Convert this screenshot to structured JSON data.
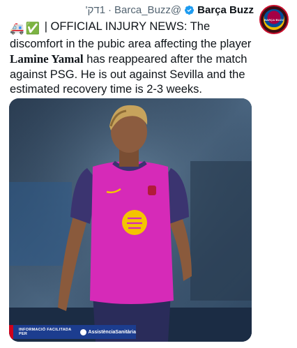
{
  "tweet": {
    "author_name": "Barça Buzz",
    "handle": "@Barca_Buzz",
    "separator": "·",
    "time": "1דק'",
    "emoji_1": "🚑",
    "emoji_2": "✅",
    "text_lead": "| OFFICIAL INJURY NEWS: The discomfort in the pubic area affecting the player ",
    "player_name": "Lamine Yamal",
    "text_tail": " has reappeared after the match against PSG. He is out against Sevilla and the estimated recovery time is 2-3 weeks.",
    "avatar_text": "BARÇA BUZZ"
  },
  "media": {
    "sponsor_text": "INFORMACIÓ FACILITADA PER",
    "sponsor_brand": "AssistènciaSanitària"
  },
  "colors": {
    "verified": "#1d9bf0",
    "shirt": "#d62ab8",
    "shirt_sleeve": "#3b3470",
    "sponsor_bar": "#1c3d8f"
  }
}
